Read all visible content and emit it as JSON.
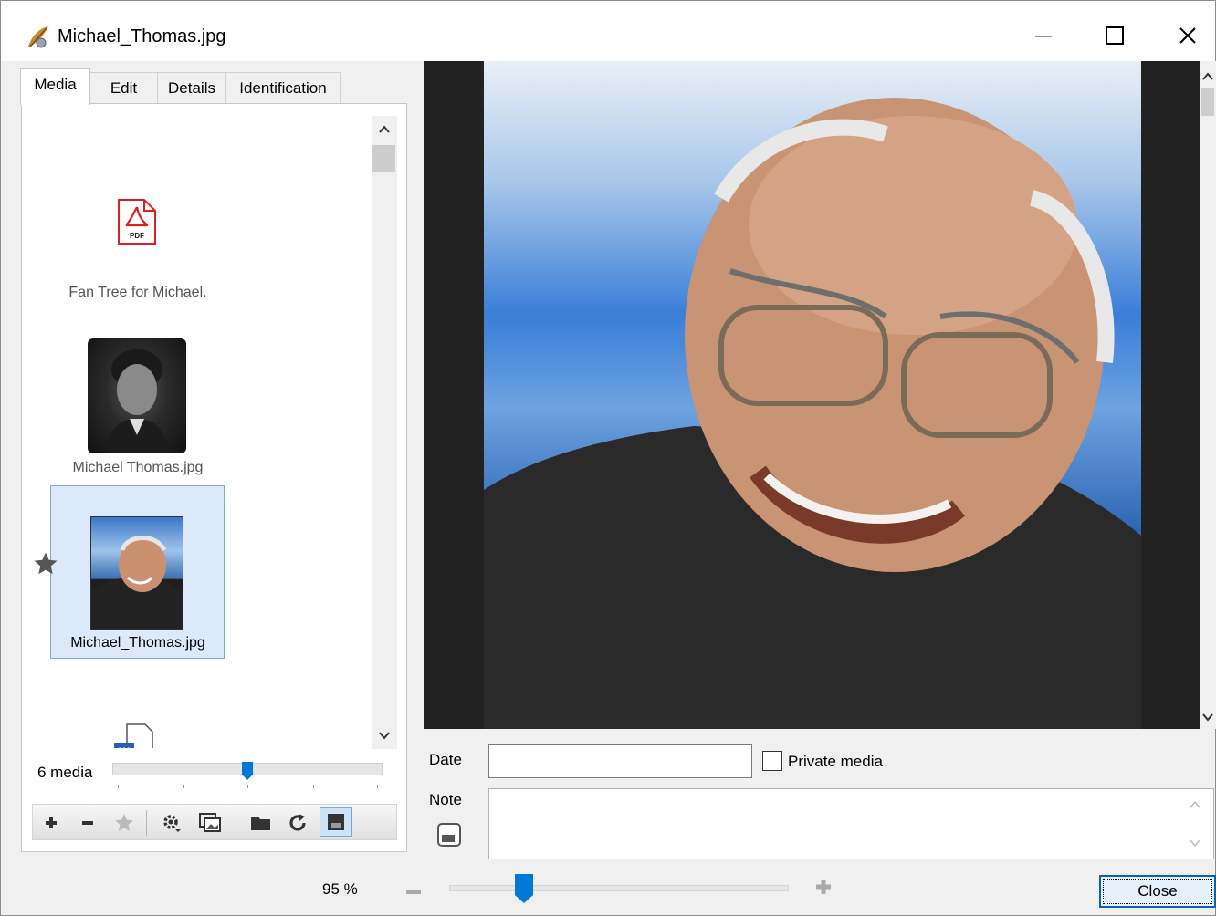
{
  "window": {
    "title": "Michael_Thomas.jpg",
    "icons": {
      "app": "quill-icon",
      "minimize": "minimize-icon",
      "maximize": "maximize-icon",
      "close": "close-icon"
    }
  },
  "tabs": [
    {
      "label": "Media",
      "active": true
    },
    {
      "label": "Edit",
      "active": false
    },
    {
      "label": "Details",
      "active": false
    },
    {
      "label": "Identification",
      "active": false
    }
  ],
  "media_list": {
    "items": [
      {
        "label": "Fan Tree for Michael.",
        "icon": "pdf-file-icon",
        "selected": false,
        "primary": false
      },
      {
        "label": "Michael Thomas.jpg",
        "icon": "photo-thumbnail",
        "selected": false,
        "primary": false
      },
      {
        "label": "Michael_Thomas.jpg",
        "icon": "photo-thumbnail",
        "selected": true,
        "primary": true
      },
      {
        "label": "",
        "icon": "word-file-icon",
        "selected": false,
        "primary": false
      }
    ],
    "count_label": "6 media"
  },
  "toolbar": {
    "icons": [
      "add-icon",
      "remove-icon",
      "star-icon",
      "gear-icon",
      "images-icon",
      "folder-icon",
      "refresh-icon",
      "save-icon"
    ]
  },
  "form": {
    "date_label": "Date",
    "date_value": "",
    "private_label": "Private media",
    "private_checked": false,
    "note_label": "Note",
    "note_value": ""
  },
  "footer": {
    "zoom_label": "95 %",
    "zoom_value_percent": 95,
    "close_label": "Close"
  },
  "colors": {
    "accent": "#0078d7",
    "selection_bg": "#dbe9fb",
    "selection_border": "#7aa7e0",
    "pdf_red": "#e02020"
  }
}
